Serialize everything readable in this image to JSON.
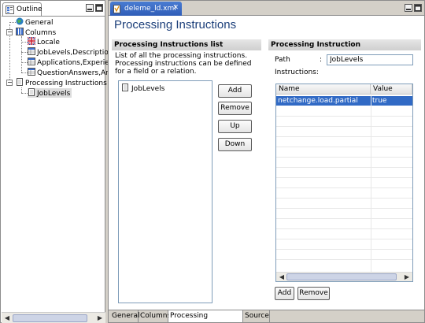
{
  "outline": {
    "tab_label": "Outline",
    "tree": [
      {
        "label": "General",
        "icon": "globe-icon"
      },
      {
        "label": "Columns",
        "icon": "columns-icon"
      },
      {
        "label": "Locale",
        "icon": "flag-icon"
      },
      {
        "label": "JobLevels,Description",
        "icon": "table-icon"
      },
      {
        "label": "Applications,Experien",
        "icon": "table-icon"
      },
      {
        "label": "QuestionAnswers,Ans",
        "icon": "table-icon"
      },
      {
        "label": "Processing Instructions",
        "icon": "document-icon"
      },
      {
        "label": "JobLevels",
        "icon": "document-icon"
      }
    ],
    "expanders": [
      "−",
      "−"
    ]
  },
  "editor": {
    "tab_label": "deleme_ld.xml",
    "title": "Processing Instructions",
    "list_section": {
      "header": "Processing Instructions list",
      "description": "List of all the processing instructions. Processing instructions can be defined for a field or a relation.",
      "items": [
        "JobLevels"
      ],
      "buttons": {
        "add": "Add",
        "remove": "Remove",
        "up": "Up",
        "down": "Down"
      }
    },
    "detail_section": {
      "header": "Processing Instruction",
      "path_label": "Path",
      "path_colon": ":",
      "path_value": "JobLevels",
      "instructions_label": "Instructions:",
      "columns": [
        "Name",
        "Value"
      ],
      "rows": [
        {
          "name": "netchange.load.partial",
          "value": "true"
        }
      ],
      "buttons": {
        "add": "Add",
        "remove": "Remove"
      }
    },
    "bottom_tabs": [
      "General",
      "Columns",
      "Processing Instructions",
      "Source"
    ],
    "active_bottom_tab": "Processing Instructions"
  },
  "colors": {
    "selection": "#316ac5",
    "title": "#1c3f7a",
    "active_tab": "#3a6cc8"
  }
}
